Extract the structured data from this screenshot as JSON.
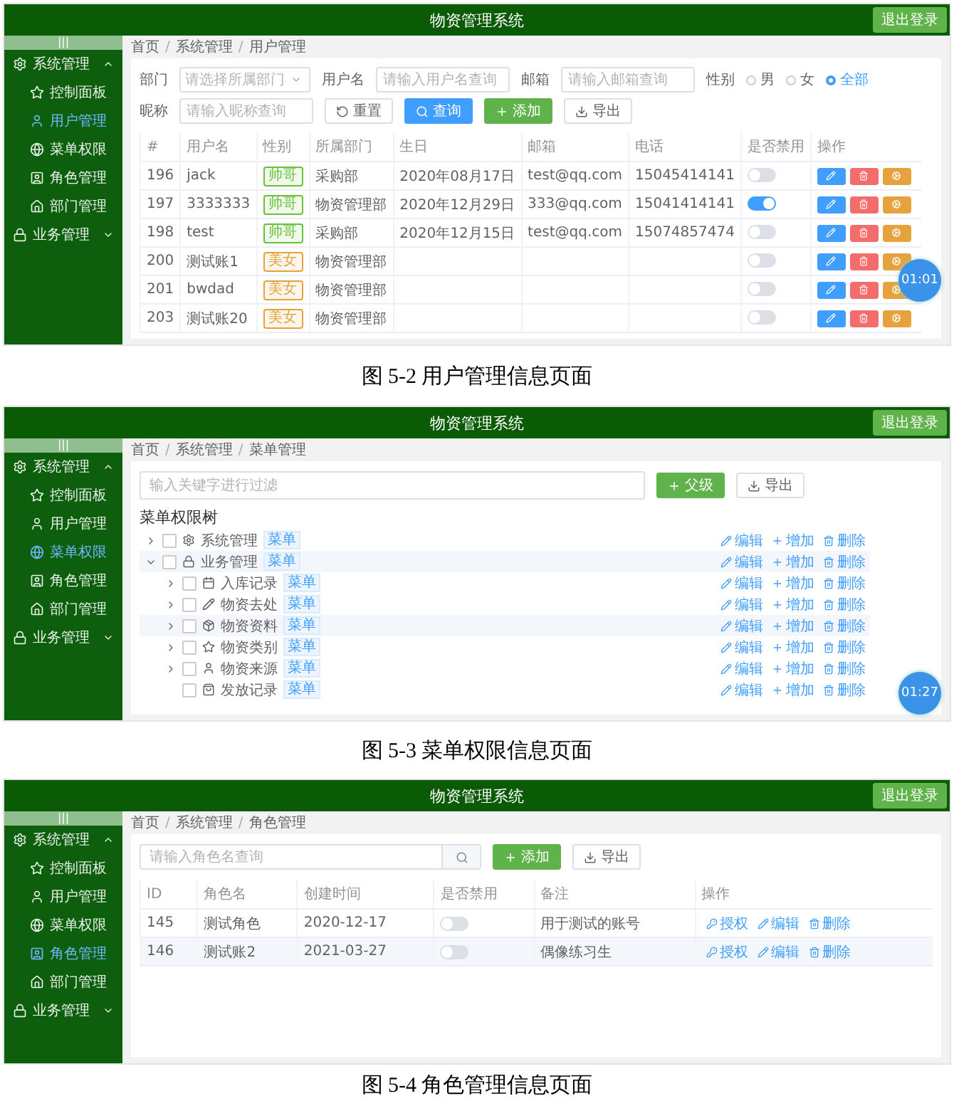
{
  "screens": [
    {
      "kind": "users",
      "header": {
        "title": "物资管理系统",
        "logout": "退出登录"
      },
      "sidebar": {
        "toggle": "|||",
        "groups": [
          {
            "label": "系统管理",
            "expanded": true,
            "items": [
              {
                "label": "控制面板",
                "selected": false
              },
              {
                "label": "用户管理",
                "selected": true
              },
              {
                "label": "菜单权限",
                "selected": false
              },
              {
                "label": "角色管理",
                "selected": false
              },
              {
                "label": "部门管理",
                "selected": false
              }
            ]
          },
          {
            "label": "业务管理",
            "expanded": false
          }
        ]
      },
      "breadcrumb": {
        "separator": "/",
        "items": [
          "首页",
          "系统管理",
          "用户管理"
        ]
      },
      "filter_rows": [
        {
          "items": [
            {
              "kind": "select",
              "label": "部门",
              "placeholder": "请选择所属部门"
            },
            {
              "kind": "input",
              "label": "用户名",
              "placeholder": "请输入用户名查询"
            },
            {
              "kind": "input",
              "label": "邮箱",
              "placeholder": "请输入邮箱查询"
            },
            {
              "kind": "radio",
              "label": "性别",
              "options": [
                {
                  "label": "男",
                  "selected": false
                },
                {
                  "label": "女",
                  "selected": false
                },
                {
                  "label": "全部",
                  "selected": true
                }
              ]
            }
          ]
        },
        {
          "items": [
            {
              "kind": "input",
              "label": "昵称",
              "placeholder": "请输入昵称查询"
            },
            {
              "kind": "reset",
              "label": "重置"
            },
            {
              "kind": "search",
              "label": "查询"
            },
            {
              "kind": "add",
              "label": "添加"
            },
            {
              "kind": "export",
              "label": "导出"
            }
          ]
        }
      ],
      "table": {
        "columns": [
          "#",
          "用户名",
          "性别",
          "所属部门",
          "生日",
          "邮箱",
          "电话",
          "是否禁用",
          "操作"
        ],
        "rows": [
          {
            "id": "196",
            "username": "jack",
            "gender": "帅哥",
            "color": "#67c23a",
            "department": "采购部",
            "birthday": "2020年08月17日",
            "email": "test@qq.com",
            "phone": "15045414141",
            "switch_on": false
          },
          {
            "id": "197",
            "username": "3333333",
            "gender": "帅哥",
            "color": "#67c23a",
            "department": "物资管理部",
            "birthday": "2020年12月29日",
            "email": "333@qq.com",
            "phone": "15041414141",
            "switch_on": true
          },
          {
            "id": "198",
            "username": "test",
            "gender": "帅哥",
            "color": "#67c23a",
            "department": "采购部",
            "birthday": "2020年12月15日",
            "email": "test@qq.com",
            "phone": "15074857474",
            "switch_on": false
          },
          {
            "id": "200",
            "username": "测试账1",
            "gender": "美女",
            "color": "#e6a23c",
            "department": "物资管理部",
            "switch_on": false
          },
          {
            "id": "201",
            "username": "bwdad",
            "gender": "美女",
            "color": "#e6a23c",
            "department": "物资管理部",
            "switch_on": false
          },
          {
            "id": "203",
            "username": "测试账20",
            "gender": "美女",
            "color": "#e6a23c",
            "department": "物资管理部",
            "switch_on": false
          }
        ]
      },
      "timer": "01:01",
      "caption": "图 5-2 用户管理信息页面"
    },
    {
      "kind": "menus",
      "header": {
        "title": "物资管理系统",
        "logout": "退出登录"
      },
      "sidebar": {
        "toggle": "|||",
        "groups": [
          {
            "label": "系统管理",
            "expanded": true,
            "items": [
              {
                "label": "控制面板",
                "selected": false
              },
              {
                "label": "用户管理",
                "selected": false
              },
              {
                "label": "菜单权限",
                "selected": true
              },
              {
                "label": "角色管理",
                "selected": false
              },
              {
                "label": "部门管理",
                "selected": false
              }
            ]
          },
          {
            "label": "业务管理",
            "expanded": false
          }
        ]
      },
      "breadcrumb": {
        "separator": "/",
        "items": [
          "首页",
          "系统管理",
          "菜单管理"
        ]
      },
      "toolbar": {
        "placeholder": "输入关键字进行过滤",
        "buttons": [
          {
            "kind": "add",
            "label": "父级"
          },
          {
            "kind": "export",
            "label": "导出"
          }
        ]
      },
      "tree_title": "菜单权限树",
      "tree": [
        {
          "label": "系统管理",
          "tag": "菜单",
          "expandable": true,
          "expanded": false,
          "checked": false,
          "highlighted": false,
          "actions": [
            "编辑",
            "增加",
            "删除"
          ]
        },
        {
          "label": "业务管理",
          "tag": "菜单",
          "expandable": true,
          "expanded": true,
          "checked": false,
          "highlighted": true,
          "actions": [
            "编辑",
            "增加",
            "删除"
          ],
          "children": [
            {
              "label": "入库记录",
              "tag": "菜单",
              "expandable": true,
              "expanded": false,
              "checked": false,
              "highlighted": false,
              "actions": [
                "编辑",
                "增加",
                "删除"
              ]
            },
            {
              "label": "物资去处",
              "tag": "菜单",
              "expandable": true,
              "expanded": false,
              "checked": false,
              "highlighted": false,
              "actions": [
                "编辑",
                "增加",
                "删除"
              ]
            },
            {
              "label": "物资资料",
              "tag": "菜单",
              "expandable": true,
              "expanded": false,
              "checked": false,
              "highlighted": true,
              "actions": [
                "编辑",
                "增加",
                "删除"
              ]
            },
            {
              "label": "物资类别",
              "tag": "菜单",
              "expandable": true,
              "expanded": false,
              "checked": false,
              "highlighted": false,
              "actions": [
                "编辑",
                "增加",
                "删除"
              ]
            },
            {
              "label": "物资来源",
              "tag": "菜单",
              "expandable": true,
              "expanded": false,
              "checked": false,
              "highlighted": false,
              "actions": [
                "编辑",
                "增加",
                "删除"
              ]
            },
            {
              "label": "发放记录",
              "tag": "菜单",
              "expandable": false,
              "checked": false,
              "highlighted": false,
              "actions": [
                "编辑",
                "增加",
                "删除"
              ]
            }
          ]
        }
      ],
      "timer": "01:27",
      "caption": "图 5-3 菜单权限信息页面"
    },
    {
      "kind": "roles",
      "header": {
        "title": "物资管理系统",
        "logout": "退出登录"
      },
      "sidebar": {
        "toggle": "|||",
        "groups": [
          {
            "label": "系统管理",
            "expanded": true,
            "items": [
              {
                "label": "控制面板",
                "selected": false
              },
              {
                "label": "用户管理",
                "selected": false
              },
              {
                "label": "菜单权限",
                "selected": false
              },
              {
                "label": "角色管理",
                "selected": true
              },
              {
                "label": "部门管理",
                "selected": false
              }
            ]
          },
          {
            "label": "业务管理",
            "expanded": false
          }
        ]
      },
      "breadcrumb": {
        "separator": "/",
        "items": [
          "首页",
          "系统管理",
          "角色管理"
        ]
      },
      "toolbar": {
        "placeholder": "请输入角色名查询",
        "buttons": [
          {
            "kind": "add",
            "label": "添加"
          },
          {
            "kind": "export",
            "label": "导出"
          }
        ]
      },
      "table": {
        "columns": [
          "ID",
          "角色名",
          "创建时间",
          "是否禁用",
          "备注",
          "操作"
        ],
        "rows": [
          {
            "id": "145",
            "name": "测试角色",
            "created": "2020-12-17",
            "switch_on": false,
            "note": "用于测试的账号",
            "highlighted": false,
            "actions": [
              "授权",
              "编辑",
              "删除"
            ]
          },
          {
            "id": "146",
            "name": "测试账2",
            "created": "2021-03-27",
            "switch_on": false,
            "note": "偶像练习生",
            "highlighted": true,
            "actions": [
              "授权",
              "编辑",
              "删除"
            ]
          }
        ]
      },
      "caption": "图 5-4 角色管理信息页面"
    }
  ]
}
